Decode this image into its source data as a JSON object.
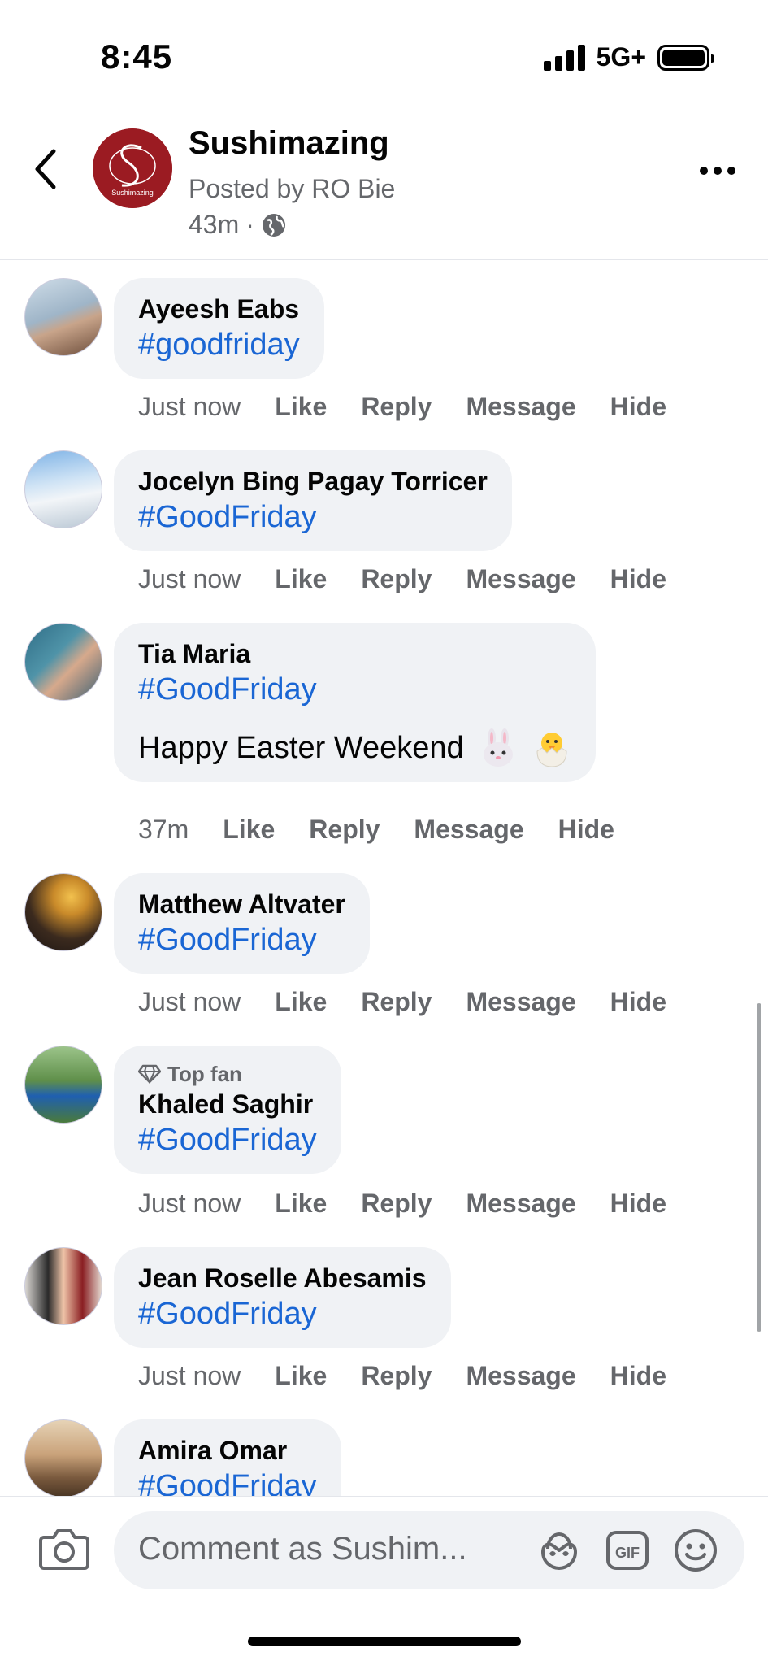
{
  "status_bar": {
    "time": "8:45",
    "network": "5G+"
  },
  "header": {
    "page_name": "Sushimazing",
    "logo_text": "Sushimazing",
    "posted_by": "Posted by RO Bie",
    "time": "43m",
    "separator": "·"
  },
  "comments": [
    {
      "author": "Ayeesh Eabs",
      "hashtag": "#goodfriday",
      "time": "Just now"
    },
    {
      "author": "Jocelyn Bing Pagay Torricer",
      "hashtag": "#GoodFriday",
      "time": "Just now"
    },
    {
      "author": "Tia Maria",
      "hashtag": "#GoodFriday",
      "text": "Happy Easter Weekend",
      "time": "37m"
    },
    {
      "author": "Matthew Altvater",
      "hashtag": "#GoodFriday",
      "time": "Just now"
    },
    {
      "badge": "Top fan",
      "author": "Khaled Saghir",
      "hashtag": "#GoodFriday",
      "time": "Just now"
    },
    {
      "author": "Jean Roselle Abesamis",
      "hashtag": "#GoodFriday",
      "time": "Just now"
    },
    {
      "author": "Amira Omar",
      "hashtag": "#GoodFriday"
    }
  ],
  "action_labels": {
    "like": "Like",
    "reply": "Reply",
    "message": "Message",
    "hide": "Hide"
  },
  "composer": {
    "placeholder": "Comment as Sushim...",
    "gif_label": "GIF"
  },
  "colors": {
    "hashtag": "#1a66d4",
    "bubble": "#f0f2f5",
    "secondary_text": "#65676b",
    "logo_bg": "#9b1b22"
  },
  "icons": [
    "back-arrow-icon",
    "globe-icon",
    "more-icon",
    "diamond-icon",
    "bunny-emoji-icon",
    "chick-emoji-icon",
    "camera-icon",
    "avatar-sticker-icon",
    "gif-icon",
    "emoji-icon"
  ]
}
